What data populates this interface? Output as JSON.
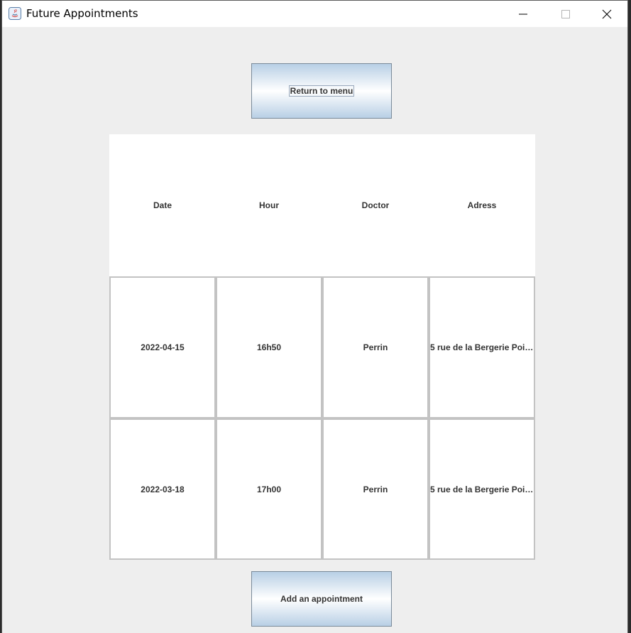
{
  "window": {
    "title": "Future Appointments",
    "icon": "java-icon",
    "controls": [
      "minimize-icon",
      "maximize-icon",
      "close-icon"
    ]
  },
  "buttons": {
    "return_label": "Return to menu",
    "add_label": "Add an appointment"
  },
  "table": {
    "headers": [
      "Date",
      "Hour",
      "Doctor",
      "Adress"
    ],
    "rows": [
      [
        "2022-04-15",
        "16h50",
        "Perrin",
        "5 rue de la Bergerie Poit..."
      ],
      [
        "2022-03-18",
        "17h00",
        "Perrin",
        "5 rue de la Bergerie Poit..."
      ]
    ]
  },
  "colors": {
    "window_bg": "#eeeeee",
    "button_gradient_edge": "#b8cfe5",
    "cell_border": "#c3c3c3"
  }
}
